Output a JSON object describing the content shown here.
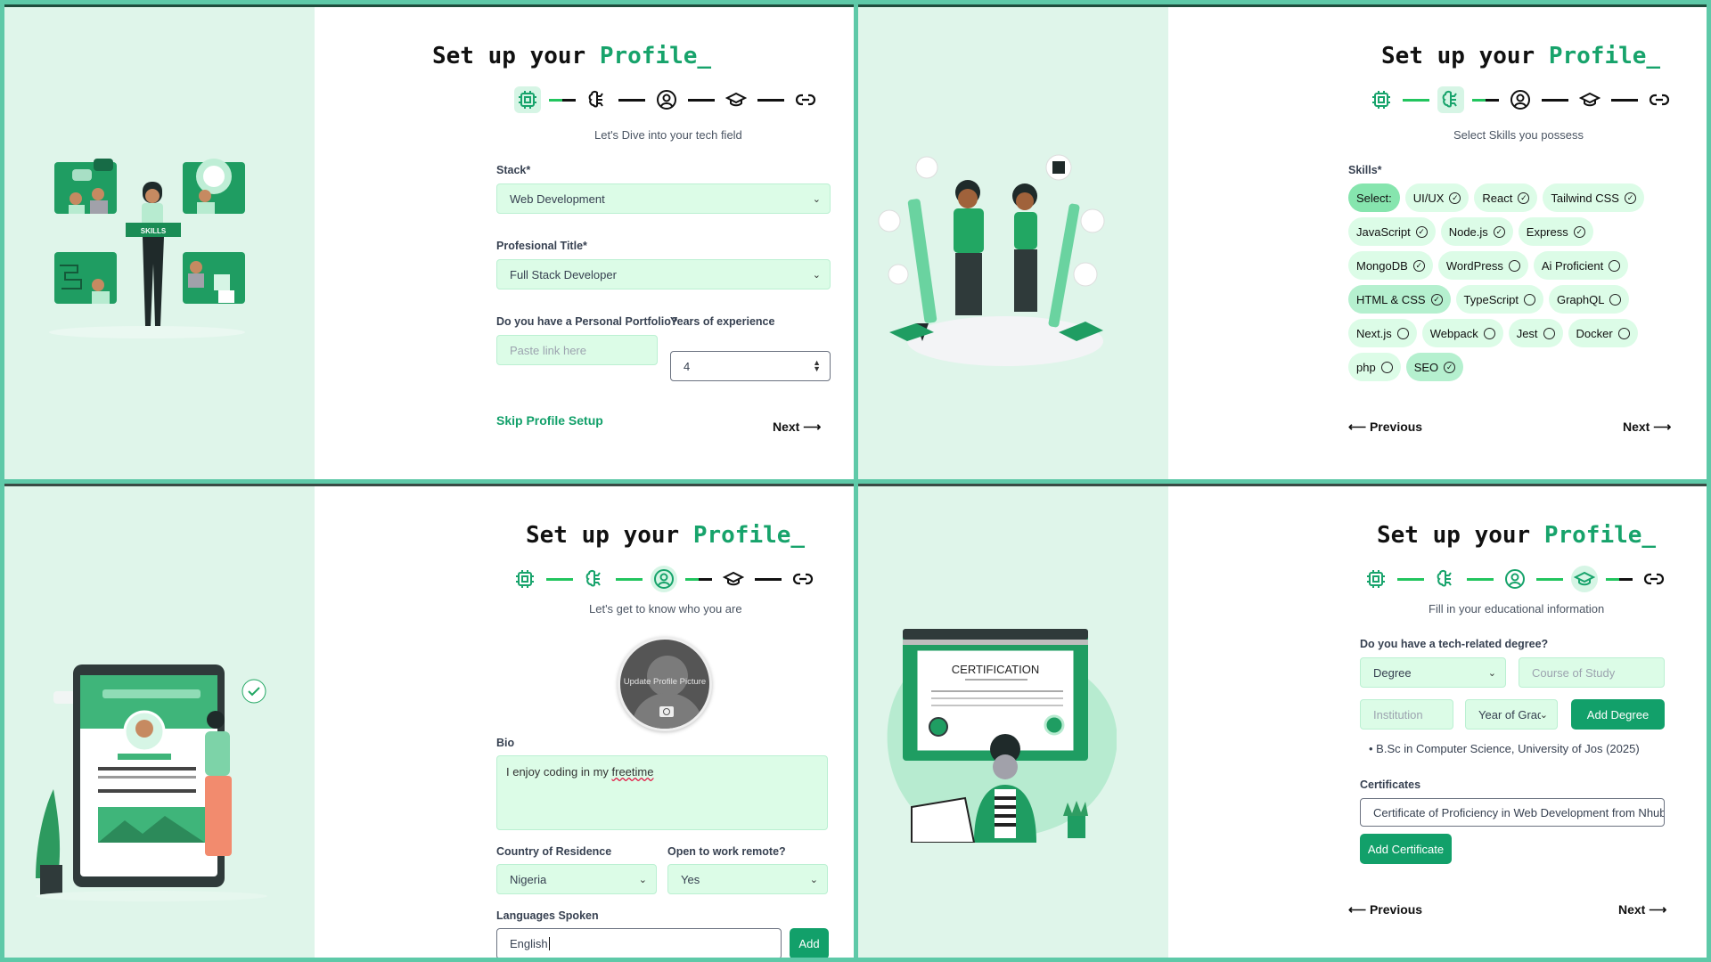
{
  "colors": {
    "accent": "#12a06a",
    "frame": "#5ec9a8",
    "mint": "#dff5ea",
    "field": "#dcfce7"
  },
  "common": {
    "title_prefix": "Set up your ",
    "title_accent": "Profile_",
    "steps": [
      {
        "icon": "cpu-chip-icon"
      },
      {
        "icon": "brain-icon"
      },
      {
        "icon": "user-circle-icon"
      },
      {
        "icon": "graduation-cap-icon"
      },
      {
        "icon": "link-icon"
      }
    ],
    "next_label": "Next ⟶",
    "previous_label": "⟵ Previous"
  },
  "panel1": {
    "active_step": 1,
    "subtitle": "Let's Dive into your tech field",
    "stack_label": "Stack*",
    "stack_value": "Web Development",
    "title_label": "Profesional Title*",
    "title_value": "Full Stack Developer",
    "portfolio_label": "Do you have a Personal Portfolio?",
    "portfolio_placeholder": "Paste link here",
    "years_label": "Years of experience",
    "years_value": "4",
    "skip_label": "Skip Profile Setup",
    "illustration_text": "SKILLS"
  },
  "panel2": {
    "active_step": 2,
    "subtitle": "Select Skills you possess",
    "skills_label": "Skills*",
    "skills": [
      {
        "name": "Select:",
        "state": "header"
      },
      {
        "name": "UI/UX",
        "state": "checked"
      },
      {
        "name": "React",
        "state": "checked"
      },
      {
        "name": "Tailwind CSS",
        "state": "checked"
      },
      {
        "name": "JavaScript",
        "state": "checked"
      },
      {
        "name": "Node.js",
        "state": "checked"
      },
      {
        "name": "Express",
        "state": "checked"
      },
      {
        "name": "MongoDB",
        "state": "checked"
      },
      {
        "name": "WordPress",
        "state": "unchecked"
      },
      {
        "name": "Ai Proficient",
        "state": "unchecked"
      },
      {
        "name": "HTML & CSS",
        "state": "selected"
      },
      {
        "name": "TypeScript",
        "state": "unchecked"
      },
      {
        "name": "GraphQL",
        "state": "unchecked"
      },
      {
        "name": "Next.js",
        "state": "unchecked"
      },
      {
        "name": "Webpack",
        "state": "unchecked"
      },
      {
        "name": "Jest",
        "state": "unchecked"
      },
      {
        "name": "Docker",
        "state": "unchecked"
      },
      {
        "name": "php",
        "state": "unchecked"
      },
      {
        "name": "SEO",
        "state": "selected"
      }
    ]
  },
  "panel3": {
    "active_step": 3,
    "subtitle": "Let's get to know who you are",
    "avatar_text": "Update Profile Picture",
    "bio_label": "Bio",
    "bio_text_plain": "I enjoy coding in my ",
    "bio_text_flagged": "freetime",
    "country_label": "Country of Residence",
    "country_value": "Nigeria",
    "remote_label": "Open to work remote?",
    "remote_value": "Yes",
    "languages_label": "Languages Spoken",
    "languages_value": "English",
    "add_label": "Add"
  },
  "panel4": {
    "active_step": 4,
    "subtitle": "Fill in your educational information",
    "degree_label": "Do you have a tech-related degree?",
    "degree_value": "Degree",
    "course_placeholder": "Course of Study",
    "institution_placeholder": "Institution",
    "year_value": "Year of Grad",
    "add_degree_label": "Add Degree",
    "degrees": [
      "• B.Sc in Computer Science, University of Jos (2025)"
    ],
    "certificates_label": "Certificates",
    "certificate_value": "Certificate of Proficiency in Web Development from Nhub F",
    "add_certificate_label": "Add Certificate",
    "illustration_text": "CERTIFICATION"
  }
}
